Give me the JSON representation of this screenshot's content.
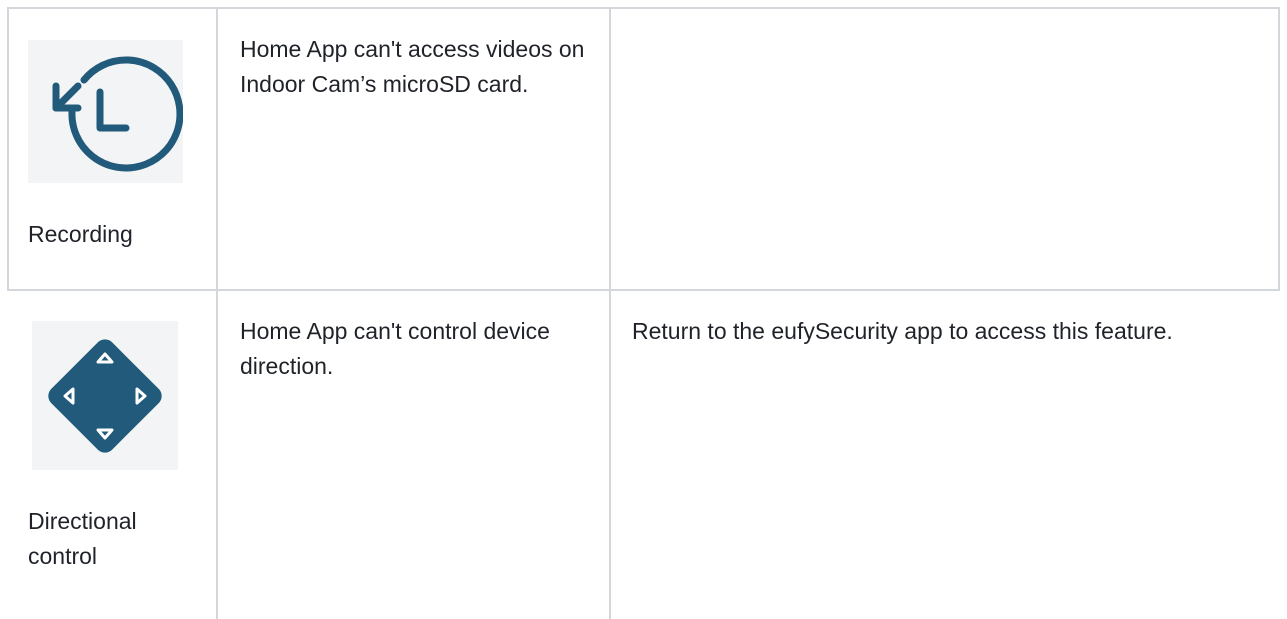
{
  "table": {
    "rows": [
      {
        "icon": "history-clock-icon",
        "label": "Recording",
        "description": "Home App can't access videos on Indoor Cam’s microSD card.",
        "solution": ""
      },
      {
        "icon": "directional-pad-icon",
        "label_line1": "Directional",
        "label_line2": "control",
        "description": "Home App can't control device direction.",
        "solution": "Return to the eufySecurity app to access this feature."
      }
    ]
  },
  "colors": {
    "icon_primary": "#215a7b",
    "grid": "#d3d6da",
    "icon_bg": "#f3f4f5"
  }
}
